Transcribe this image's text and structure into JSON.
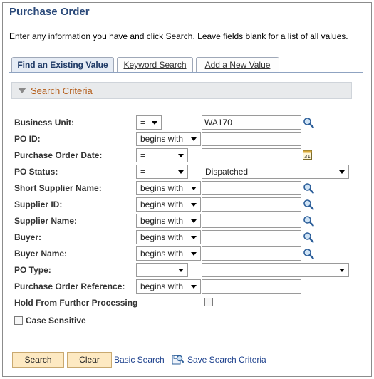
{
  "page": {
    "title": "Purchase Order",
    "instructions": "Enter any information you have and click Search. Leave fields blank for a list of all values."
  },
  "tabs": [
    {
      "label": "Find an Existing Value",
      "active": true
    },
    {
      "label": "Keyword Search",
      "active": false
    },
    {
      "label": "Add a New Value",
      "active": false
    }
  ],
  "criteria": {
    "label": "Search Criteria"
  },
  "fields": {
    "business_unit": {
      "label": "Business Unit:",
      "operator": "=",
      "value": "WA170"
    },
    "po_id": {
      "label": "PO ID:",
      "operator": "begins with",
      "value": ""
    },
    "po_date": {
      "label": "Purchase Order Date:",
      "operator": "=",
      "value": ""
    },
    "po_status": {
      "label": "PO Status:",
      "operator": "=",
      "value": "Dispatched"
    },
    "short_supplier": {
      "label": "Short Supplier Name:",
      "operator": "begins with",
      "value": ""
    },
    "supplier_id": {
      "label": "Supplier ID:",
      "operator": "begins with",
      "value": ""
    },
    "supplier_name": {
      "label": "Supplier Name:",
      "operator": "begins with",
      "value": ""
    },
    "buyer": {
      "label": "Buyer:",
      "operator": "begins with",
      "value": ""
    },
    "buyer_name": {
      "label": "Buyer Name:",
      "operator": "begins with",
      "value": ""
    },
    "po_type": {
      "label": "PO Type:",
      "operator": "=",
      "value": ""
    },
    "po_reference": {
      "label": "Purchase Order Reference:",
      "operator": "begins with",
      "value": ""
    },
    "hold": {
      "label": "Hold From Further Processing",
      "checked": false
    }
  },
  "case_sensitive": {
    "label": "Case Sensitive",
    "checked": false
  },
  "buttons": {
    "search": "Search",
    "clear": "Clear",
    "basic_search": "Basic Search",
    "save_criteria": "Save Search Criteria"
  },
  "icons": {
    "lookup": "magnifier-icon",
    "calendar": "calendar-icon",
    "save": "save-search-icon"
  },
  "colors": {
    "title": "#2b4a7a",
    "criteria_label": "#b35b17",
    "button_bg": "#fde9c2",
    "link": "#1b3f8c"
  }
}
